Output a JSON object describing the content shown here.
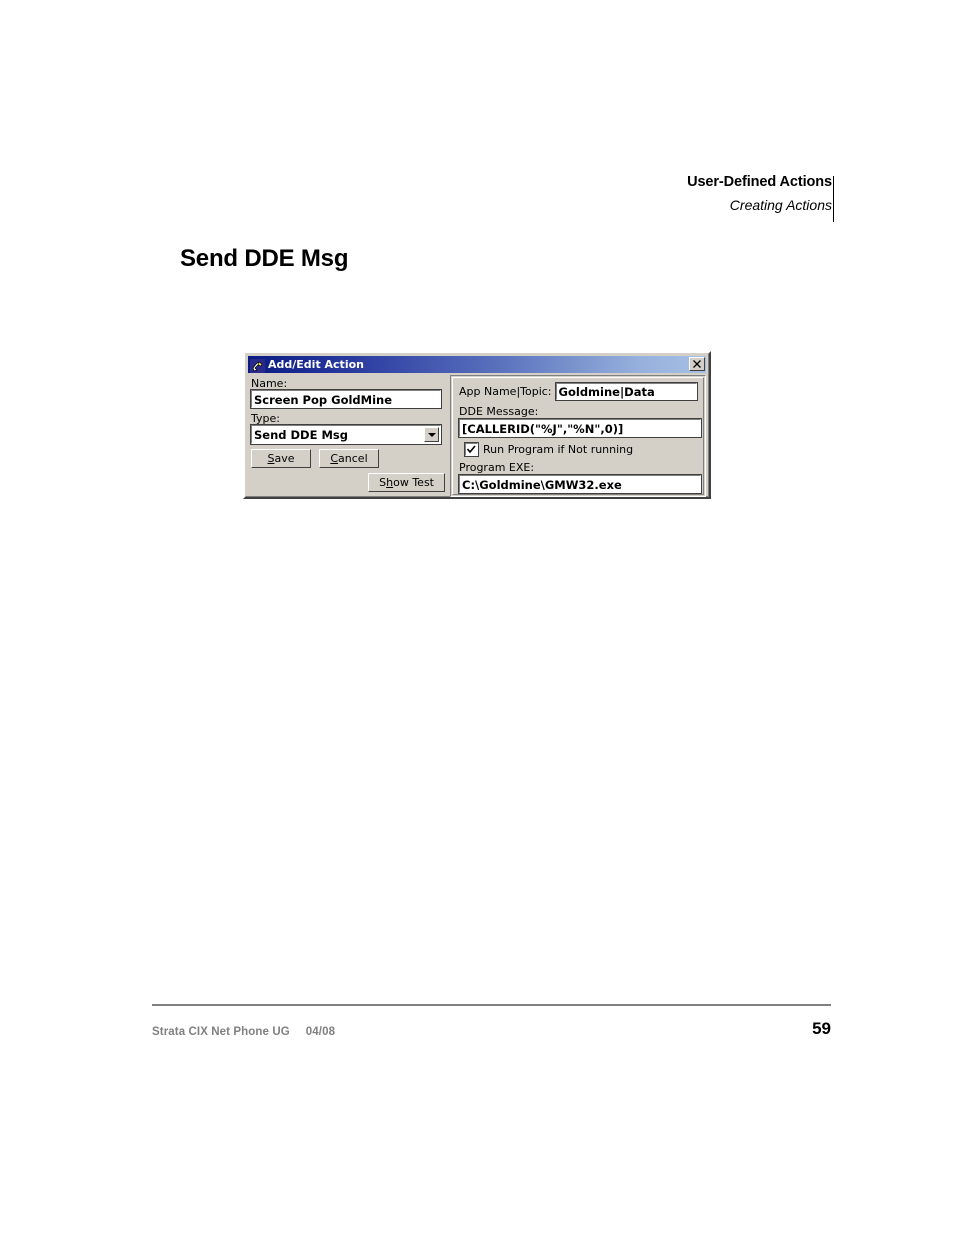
{
  "running_head": {
    "title": "User-Defined Actions",
    "subtitle": "Creating Actions"
  },
  "page_heading": "Send DDE Msg",
  "dialog": {
    "title": "Add/Edit Action",
    "title_icon": "phone-handset-icon",
    "close_label": "✕",
    "left": {
      "name_label": "Name:",
      "name_value": "Screen Pop GoldMine",
      "type_label": "Type:",
      "type_value": "Send DDE Msg",
      "save_label_pre": "",
      "save_label_key": "S",
      "save_label_post": "ave",
      "cancel_label_pre": "",
      "cancel_label_key": "C",
      "cancel_label_post": "ancel",
      "showtest_label_pre": "S",
      "showtest_label_key": "h",
      "showtest_label_post": "ow Test"
    },
    "right": {
      "topic_label": "App Name|Topic:",
      "topic_value": "Goldmine|Data",
      "dde_label": "DDE Message:",
      "dde_value": "[CALLERID(\"%J\",\"%N\",0)]",
      "run_program_label": "Run Program if Not running",
      "run_program_checked": true,
      "exe_label": "Program EXE:",
      "exe_value": "C:\\Goldmine\\GMW32.exe"
    }
  },
  "footer": {
    "document": "Strata CIX Net Phone UG",
    "date": "04/08",
    "page_number": "59"
  },
  "colors": {
    "titlebar_start": "#0a1b80",
    "titlebar_end": "#a6c0e4",
    "dialog_face": "#d4d0c8",
    "footer_gray": "#808080"
  }
}
